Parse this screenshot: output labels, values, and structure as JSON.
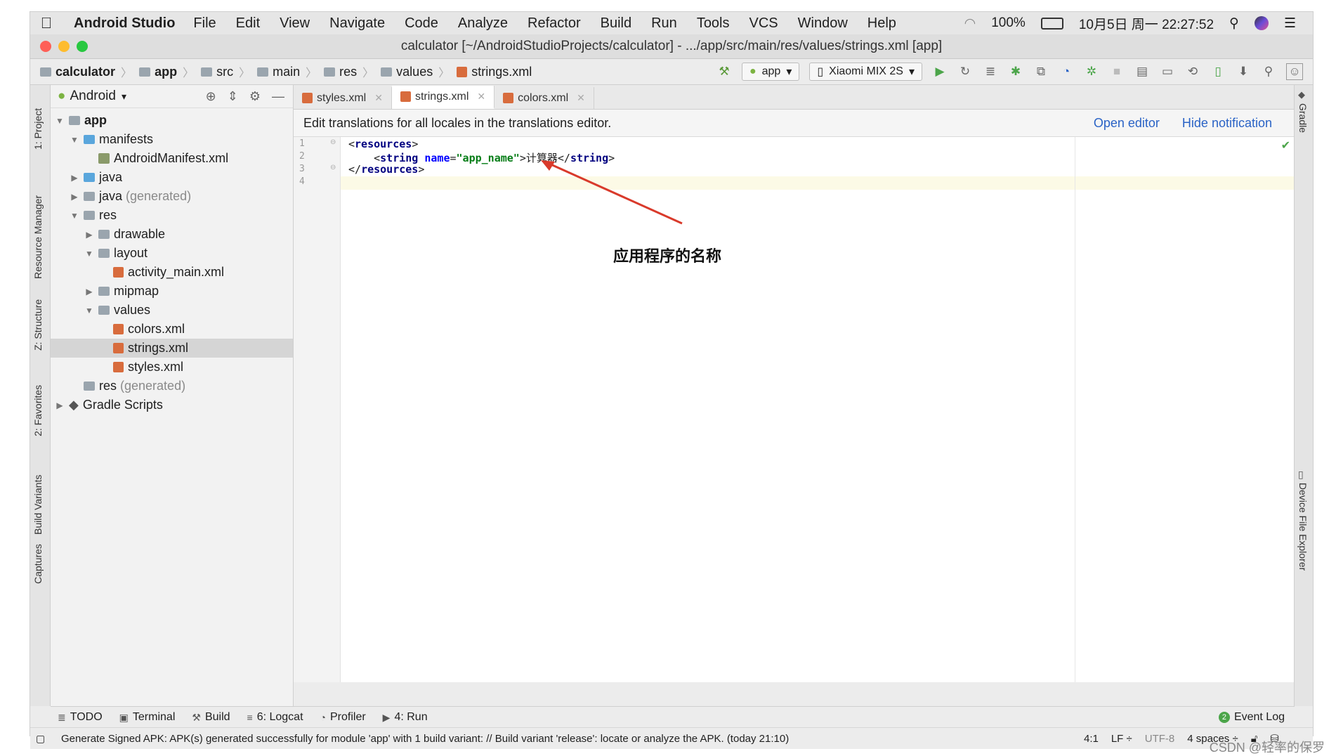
{
  "menubar": {
    "app_name": "Android Studio",
    "items": [
      "File",
      "Edit",
      "View",
      "Navigate",
      "Code",
      "Analyze",
      "Refactor",
      "Build",
      "Run",
      "Tools",
      "VCS",
      "Window",
      "Help"
    ],
    "battery": "100%",
    "datetime": "10月5日 周一  22:27:52"
  },
  "window": {
    "title": "calculator [~/AndroidStudioProjects/calculator] - .../app/src/main/res/values/strings.xml [app]"
  },
  "breadcrumb": [
    "calculator",
    "app",
    "src",
    "main",
    "res",
    "values",
    "strings.xml"
  ],
  "toolbar": {
    "run_config": "app",
    "device": "Xiaomi MIX 2S"
  },
  "project_panel": {
    "view_mode": "Android",
    "tree": [
      {
        "label": "app",
        "indent": 0,
        "toggle": "▼",
        "icon": "folder",
        "bold": true
      },
      {
        "label": "manifests",
        "indent": 1,
        "toggle": "▼",
        "icon": "folder-blue"
      },
      {
        "label": "AndroidManifest.xml",
        "indent": 2,
        "toggle": "",
        "icon": "manifest"
      },
      {
        "label": "java",
        "indent": 1,
        "toggle": "▶",
        "icon": "folder-blue"
      },
      {
        "label": "java",
        "suffix": "(generated)",
        "indent": 1,
        "toggle": "▶",
        "icon": "folder-gen"
      },
      {
        "label": "res",
        "indent": 1,
        "toggle": "▼",
        "icon": "folder"
      },
      {
        "label": "drawable",
        "indent": 2,
        "toggle": "▶",
        "icon": "folder"
      },
      {
        "label": "layout",
        "indent": 2,
        "toggle": "▼",
        "icon": "folder"
      },
      {
        "label": "activity_main.xml",
        "indent": 3,
        "toggle": "",
        "icon": "xml"
      },
      {
        "label": "mipmap",
        "indent": 2,
        "toggle": "▶",
        "icon": "folder"
      },
      {
        "label": "values",
        "indent": 2,
        "toggle": "▼",
        "icon": "folder"
      },
      {
        "label": "colors.xml",
        "indent": 3,
        "toggle": "",
        "icon": "xml"
      },
      {
        "label": "strings.xml",
        "indent": 3,
        "toggle": "",
        "icon": "xml",
        "selected": true
      },
      {
        "label": "styles.xml",
        "indent": 3,
        "toggle": "",
        "icon": "xml"
      },
      {
        "label": "res",
        "suffix": "(generated)",
        "indent": 1,
        "toggle": "",
        "icon": "folder"
      },
      {
        "label": "Gradle Scripts",
        "indent": 0,
        "toggle": "▶",
        "icon": "gradle"
      }
    ]
  },
  "left_tools": [
    "1: Project",
    "Resource Manager",
    "Z: Structure",
    "2: Favorites",
    "Build Variants",
    "Captures"
  ],
  "right_tools": [
    "Gradle",
    "Device File Explorer"
  ],
  "tabs": [
    {
      "label": "styles.xml",
      "active": false
    },
    {
      "label": "strings.xml",
      "active": true
    },
    {
      "label": "colors.xml",
      "active": false
    }
  ],
  "notification": {
    "message": "Edit translations for all locales in the translations editor.",
    "open_editor": "Open editor",
    "hide": "Hide notification"
  },
  "editor": {
    "line_numbers": [
      "1",
      "2",
      "3",
      "4"
    ],
    "lines": [
      [
        {
          "t": "<",
          "c": "plain"
        },
        {
          "t": "resources",
          "c": "tag"
        },
        {
          "t": ">",
          "c": "plain"
        }
      ],
      [
        {
          "t": "    <",
          "c": "plain"
        },
        {
          "t": "string",
          "c": "tag"
        },
        {
          "t": " ",
          "c": "plain"
        },
        {
          "t": "name",
          "c": "attr"
        },
        {
          "t": "=",
          "c": "plain"
        },
        {
          "t": "\"app_name\"",
          "c": "val"
        },
        {
          "t": ">计算器</",
          "c": "plain"
        },
        {
          "t": "string",
          "c": "tag"
        },
        {
          "t": ">",
          "c": "plain"
        }
      ],
      [
        {
          "t": "</",
          "c": "plain"
        },
        {
          "t": "resources",
          "c": "tag"
        },
        {
          "t": ">",
          "c": "plain"
        }
      ],
      [
        {
          "t": "",
          "c": "plain"
        }
      ]
    ],
    "annotation": "应用程序的名称",
    "annotation_color": "#d93a2b"
  },
  "bottom_tools": [
    {
      "icon": "≣",
      "label": "TODO"
    },
    {
      "icon": "▣",
      "label": "Terminal"
    },
    {
      "icon": "⚒",
      "label": "Build"
    },
    {
      "icon": "≡",
      "label": "6: Logcat"
    },
    {
      "icon": "◔",
      "label": "Profiler"
    },
    {
      "icon": "▶",
      "label": "4: Run"
    }
  ],
  "event_log": {
    "badge": "2",
    "label": "Event Log"
  },
  "status": {
    "message": "Generate Signed APK: APK(s) generated successfully for module 'app' with 1 build variant: // Build variant 'release': locate or analyze the APK. (today 21:10)",
    "position": "4:1",
    "line_sep": "LF ÷",
    "encoding": "UTF-8",
    "indent": "4 spaces ÷"
  },
  "watermark": "CSDN @轻率的保罗",
  "colors": {
    "accent": "#2a63c6",
    "run_green": "#4ca54a",
    "xml_icon": "#d86c3d"
  }
}
